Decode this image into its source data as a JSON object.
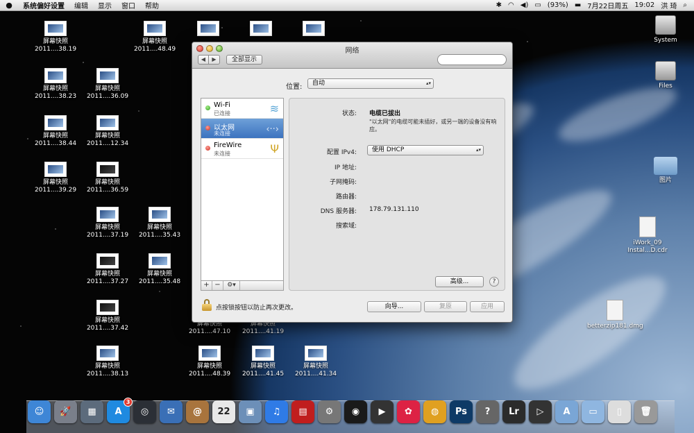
{
  "menubar": {
    "app_name": "系统偏好设置",
    "menus": [
      "编辑",
      "显示",
      "窗口",
      "帮助"
    ],
    "battery": "(93%)",
    "date": "7月22日周五",
    "time": "19:02",
    "user": "洪 琦"
  },
  "desktop": {
    "screenshots": [
      {
        "title": "屏幕快照",
        "sub": "2011....38.19"
      },
      {
        "title": "屏幕快照",
        "sub": "2011....48.49"
      },
      {
        "title": "屏幕快照",
        "sub": "2011....38.23"
      },
      {
        "title": "屏幕快照",
        "sub": "2011....36.09"
      },
      {
        "title": "屏幕快照",
        "sub": "2011....38.44"
      },
      {
        "title": "屏幕快照",
        "sub": "2011....12.34"
      },
      {
        "title": "屏幕快照",
        "sub": "2011....39.29"
      },
      {
        "title": "屏幕快照",
        "sub": "2011....36.59"
      },
      {
        "title": "屏幕快照",
        "sub": "2011....37.19"
      },
      {
        "title": "屏幕快照",
        "sub": "2011....35.43"
      },
      {
        "title": "屏幕快照",
        "sub": "2011....37.27"
      },
      {
        "title": "屏幕快照",
        "sub": "2011....35.48"
      },
      {
        "title": "屏幕快照",
        "sub": "2011....37.42"
      },
      {
        "title": "屏幕快照",
        "sub": "2011....38.13"
      },
      {
        "title": "屏幕快照",
        "sub": "2011....47.10"
      },
      {
        "title": "屏幕快照",
        "sub": "2011....41.19"
      },
      {
        "title": "屏幕快照",
        "sub": "2011....48.39"
      },
      {
        "title": "屏幕快照",
        "sub": "2011....41.45"
      },
      {
        "title": "屏幕快照",
        "sub": "2011....41.34"
      }
    ],
    "right_icons": [
      {
        "label": "System"
      },
      {
        "label": "Files"
      },
      {
        "label": "图片"
      },
      {
        "label": "iWork_09 Instal...D.cdr"
      },
      {
        "label": "betterzip181.dmg"
      }
    ]
  },
  "window": {
    "title": "网络",
    "nav_back": "◀",
    "nav_forward": "▶",
    "show_all": "全部显示",
    "search_placeholder": "",
    "location_label": "位置:",
    "location_value": "自动",
    "services": [
      {
        "name": "Wi-Fi",
        "status": "已连接",
        "icon": "wifi-icon",
        "state": "green"
      },
      {
        "name": "以太网",
        "status": "未连接",
        "icon": "ethernet-icon",
        "state": "red"
      },
      {
        "name": "FireWire",
        "status": "未连接",
        "icon": "firewire-icon",
        "state": "red"
      }
    ],
    "tools": {
      "add": "+",
      "remove": "−",
      "gear": "⚙▾"
    },
    "detail": {
      "status_label": "状态:",
      "status_value": "电缆已拔出",
      "status_note": "\"以太网\"的电缆可能未插好，或另一端的设备没有响应。",
      "ipv4_label": "配置 IPv4:",
      "ipv4_value": "使用 DHCP",
      "ip_label": "IP 地址:",
      "subnet_label": "子网掩码:",
      "router_label": "路由器:",
      "dns_label": "DNS 服务器:",
      "dns_value": "178.79.131.110",
      "search_domain_label": "搜索域:",
      "advanced_label": "高级...",
      "help_label": "?"
    },
    "lock_text": "点按锁按钮以防止再次更改。",
    "assist_label": "向导...",
    "revert_label": "复原",
    "apply_label": "应用"
  },
  "dock": {
    "items": [
      {
        "name": "finder",
        "glyph": "☺",
        "color": "#3e86d6"
      },
      {
        "name": "launchpad",
        "glyph": "🚀",
        "color": "#7a7f8a"
      },
      {
        "name": "mission-control",
        "glyph": "▦",
        "color": "#5c6b7c"
      },
      {
        "name": "app-store",
        "glyph": "A",
        "color": "#1f8ae0",
        "badge": "3"
      },
      {
        "name": "safari",
        "glyph": "◎",
        "color": "#2b2f36"
      },
      {
        "name": "mail",
        "glyph": "✉",
        "color": "#3a6fb6"
      },
      {
        "name": "contacts",
        "glyph": "@",
        "color": "#a8743d"
      },
      {
        "name": "calendar",
        "glyph": "22",
        "color": "#e8e8e8"
      },
      {
        "name": "photos",
        "glyph": "▣",
        "color": "#6c8fb8"
      },
      {
        "name": "itunes",
        "glyph": "♫",
        "color": "#2f7be6"
      },
      {
        "name": "photo-booth",
        "glyph": "▤",
        "color": "#c01e1e"
      },
      {
        "name": "system-preferences",
        "glyph": "⚙",
        "color": "#777"
      },
      {
        "name": "qq",
        "glyph": "◉",
        "color": "#1a1a1a"
      },
      {
        "name": "dvd-player",
        "glyph": "▶",
        "color": "#333"
      },
      {
        "name": "picasa",
        "glyph": "✿",
        "color": "#d24"
      },
      {
        "name": "chrome",
        "glyph": "◍",
        "color": "#e0a020"
      },
      {
        "name": "photoshop",
        "glyph": "Ps",
        "color": "#0e3a66"
      },
      {
        "name": "unknown-app",
        "glyph": "?",
        "color": "#666"
      },
      {
        "name": "lightroom",
        "glyph": "Lr",
        "color": "#2b2b2b"
      },
      {
        "name": "facetime",
        "glyph": "▷",
        "color": "#333"
      },
      {
        "name": "applications-folder",
        "glyph": "A",
        "color": "#7aa6d6"
      },
      {
        "name": "documents-folder",
        "glyph": "▭",
        "color": "#8fb6e0"
      },
      {
        "name": "document-stack",
        "glyph": "▯",
        "color": "#ddd"
      },
      {
        "name": "trash",
        "glyph": "🗑",
        "color": "#999"
      }
    ]
  }
}
